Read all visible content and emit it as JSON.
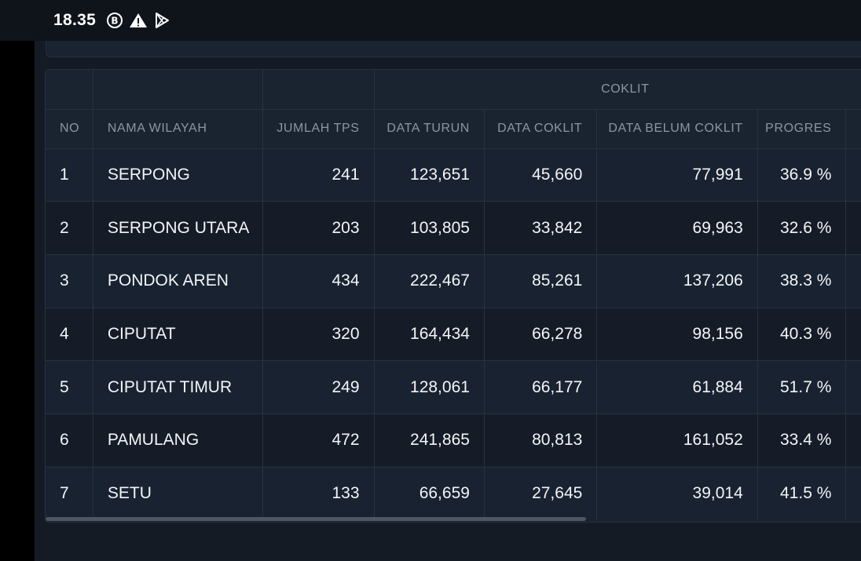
{
  "status_bar": {
    "time": "18.35",
    "icons": [
      "b-circle-icon",
      "warning-icon",
      "play-store-icon"
    ]
  },
  "table": {
    "group_header": "COKLIT",
    "columns": [
      "NO",
      "NAMA WILAYAH",
      "JUMLAH TPS",
      "DATA TURUN",
      "DATA COKLIT",
      "DATA BELUM COKLIT",
      "PROGRES"
    ],
    "rows": [
      [
        "1",
        "SERPONG",
        "241",
        "123,651",
        "45,660",
        "77,991",
        "36.9 %"
      ],
      [
        "2",
        "SERPONG UTARA",
        "203",
        "103,805",
        "33,842",
        "69,963",
        "32.6 %"
      ],
      [
        "3",
        "PONDOK AREN",
        "434",
        "222,467",
        "85,261",
        "137,206",
        "38.3 %"
      ],
      [
        "4",
        "CIPUTAT",
        "320",
        "164,434",
        "66,278",
        "98,156",
        "40.3 %"
      ],
      [
        "5",
        "CIPUTAT TIMUR",
        "249",
        "128,061",
        "66,177",
        "61,884",
        "51.7 %"
      ],
      [
        "6",
        "PAMULANG",
        "472",
        "241,865",
        "80,813",
        "161,052",
        "33.4 %"
      ],
      [
        "7",
        "SETU",
        "133",
        "66,659",
        "27,645",
        "39,014",
        "41.5 %"
      ]
    ]
  }
}
